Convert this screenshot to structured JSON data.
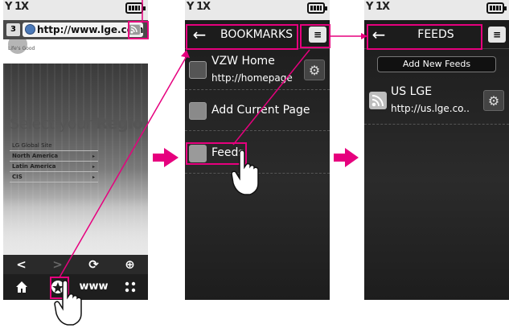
{
  "phone1": {
    "status_signal": "Y 1X",
    "tab_count": "3",
    "url": "http://www.lge.com",
    "logo_tagline": "Life's Good",
    "region_title_prefix": "Select your ",
    "region_title_bold": "Region",
    "region_items": [
      "LG Global Site",
      "North America",
      "Latin America",
      "CIS"
    ],
    "nav_row1": [
      "<",
      ">",
      "⟳",
      "⊕"
    ],
    "nav_row2_www": "www"
  },
  "phone2": {
    "status_signal": "Y 1X",
    "header_title": "BOOKMARKS",
    "bookmarks": [
      {
        "title": "VZW Home",
        "url": "http://homepage"
      },
      {
        "title": "Add Current Page"
      },
      {
        "title": "Feeds"
      }
    ]
  },
  "phone3": {
    "status_signal": "Y 1X",
    "header_title": "FEEDS",
    "add_feeds_label": "Add New Feeds",
    "feed": {
      "title": "US LGE",
      "url": "http://us.lge.co.."
    }
  },
  "colors": {
    "accent": "#e6007e"
  }
}
